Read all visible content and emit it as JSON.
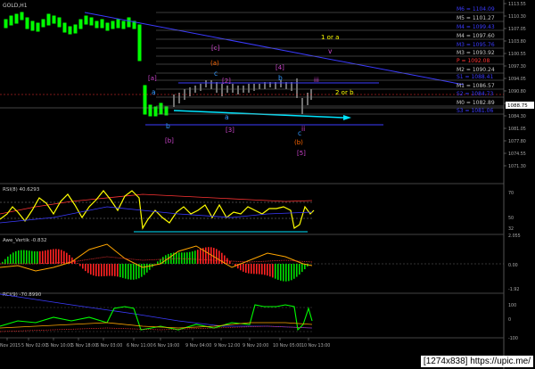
{
  "chart": {
    "symbol_label": "GOLD,H1",
    "right_axis": [
      "1113.55",
      "1110.30",
      "1107.05",
      "1103.80",
      "1100.55",
      "1097.30",
      "1094.05",
      "1090.80",
      "1087.55",
      "1084.30",
      "1081.05",
      "1077.80",
      "1074.55",
      "1071.30"
    ],
    "current_price": "1088.75"
  },
  "murrey_levels": [
    {
      "label": "M6 = 1104.09",
      "color": "#3b3bff"
    },
    {
      "label": "M5 = 1101.27",
      "color": "#c8c8c8"
    },
    {
      "label": "M4 = 1099.43",
      "color": "#3b3bff"
    },
    {
      "label": "M4 = 1097.60",
      "color": "#c8c8c8"
    },
    {
      "label": "M3 = 1095.76",
      "color": "#3b3bff"
    },
    {
      "label": "M3 = 1093.92",
      "color": "#c8c8c8"
    },
    {
      "label": "P  = 1092.08",
      "color": "#ff3333"
    },
    {
      "label": "M2 = 1090.24",
      "color": "#c8c8c8"
    },
    {
      "label": "S1 = 1088.41",
      "color": "#3b3bff"
    },
    {
      "label": "M1 = 1086.57",
      "color": "#c8c8c8"
    },
    {
      "label": "S2 = 1084.73",
      "color": "#3b3bff"
    },
    {
      "label": "M0 = 1082.89",
      "color": "#c8c8c8"
    },
    {
      "label": "S3 = 1081.06",
      "color": "#3b3bff"
    }
  ],
  "wave_labels": [
    {
      "text": "[c]",
      "color": "#cc44cc"
    },
    {
      "text": "(a)",
      "color": "#ff6600"
    },
    {
      "text": "[a]",
      "color": "#cc44cc"
    },
    {
      "text": "a",
      "color": "#3399ff"
    },
    {
      "text": "c",
      "color": "#3399ff"
    },
    {
      "text": "[2]",
      "color": "#cc44cc"
    },
    {
      "text": "[4]",
      "color": "#cc44cc"
    },
    {
      "text": "b",
      "color": "#3399ff"
    },
    {
      "text": "iii",
      "color": "#cc44cc"
    },
    {
      "text": "a",
      "color": "#3399ff"
    },
    {
      "text": "b",
      "color": "#3399ff"
    },
    {
      "text": "[b]",
      "color": "#cc44cc"
    },
    {
      "text": "[3]",
      "color": "#cc44cc"
    },
    {
      "text": "ii",
      "color": "#cc44cc"
    },
    {
      "text": "c",
      "color": "#3399ff"
    },
    {
      "text": "(b)",
      "color": "#ff6600"
    },
    {
      "text": "[5]",
      "color": "#cc44cc"
    },
    {
      "text": "1 or a",
      "color": "#ffff00"
    },
    {
      "text": "v",
      "color": "#cc44cc"
    },
    {
      "text": "2 or b",
      "color": "#ffff00"
    }
  ],
  "indicators": [
    {
      "label": "RSI(8) 40.6293",
      "axis": [
        "70",
        "50",
        "32"
      ]
    },
    {
      "label": "Awe_Vertik -0.832",
      "axis": [
        "2.055",
        "0.00",
        "-1.92"
      ]
    },
    {
      "label": "RCI(9) -70.8990",
      "axis": [
        "100",
        "0",
        "-100"
      ]
    }
  ],
  "time_axis": [
    "Nov 2015",
    "5 Nov 02:00",
    "5 Nov 10:00",
    "5 Nov 18:00",
    "6 Nov 03:00",
    "6 Nov 11:00",
    "6 Nov 19:00",
    "9 Nov 04:00",
    "9 Nov 12:00",
    "9 Nov 20:00",
    "10 Nov 05:00",
    "10 Nov 13:00"
  ],
  "watermark": "[1274x838] https://upic.me/"
}
